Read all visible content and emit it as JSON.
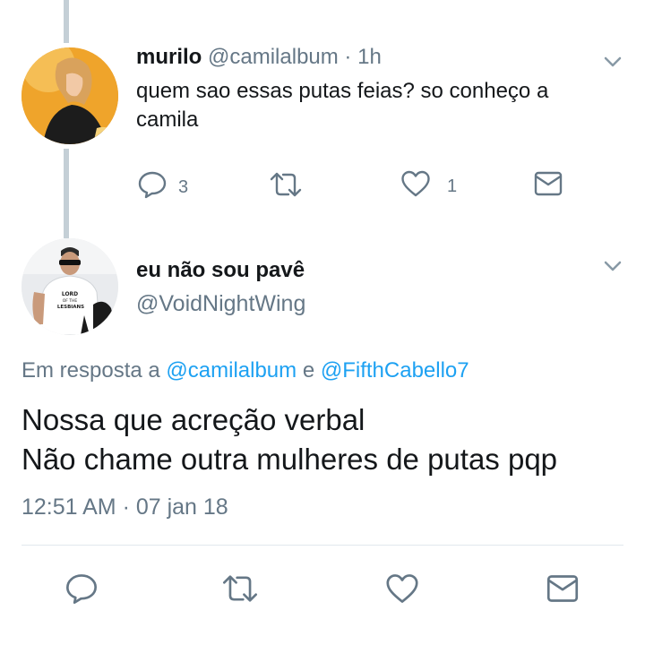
{
  "reply": {
    "name": "murilo",
    "handle": "@camilalbum",
    "separator": "·",
    "time": "1h",
    "text": "quem sao essas putas feias? so conheço a camila",
    "reply_count": "3",
    "like_count": "1"
  },
  "main": {
    "name": "eu não sou pavê",
    "handle": "@VoidNightWing",
    "reply_prefix": "Em resposta a",
    "reply_link1": "@camilalbum",
    "reply_conj": "e",
    "reply_link2": "@FifthCabello7",
    "text_line1": "Nossa que acreção verbal",
    "text_line2": "Não chame outra mulheres de putas pqp",
    "timestamp": "12:51 AM · 07 jan 18",
    "shirt_text": "LORD OF THE LESBIANS"
  },
  "icons": {
    "reply": "speech-bubble-icon",
    "retweet": "retweet-icon",
    "like": "heart-icon",
    "dm": "envelope-icon",
    "menu": "chevron-down-icon"
  },
  "colors": {
    "link": "#1da1f2",
    "muted": "#657786",
    "thread_line": "#c4cfd6"
  }
}
